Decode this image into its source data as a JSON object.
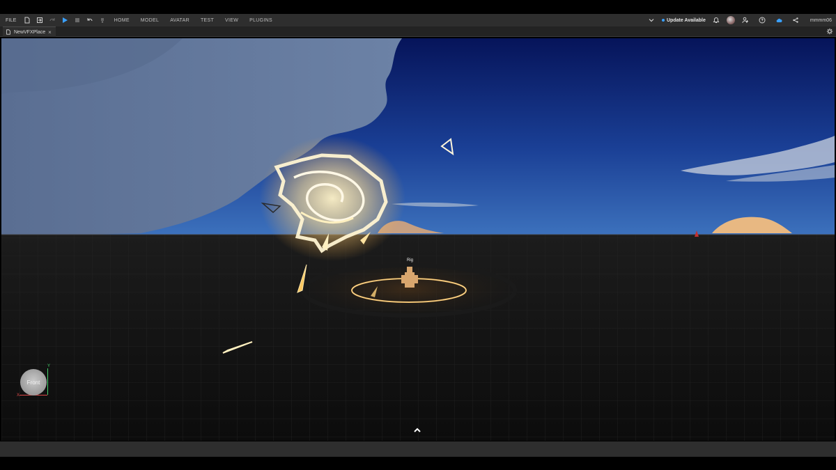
{
  "menubar": {
    "file_label": "FILE",
    "tabs": [
      "HOME",
      "MODEL",
      "AVATAR",
      "TEST",
      "VIEW",
      "PLUGINS"
    ],
    "update_label": "Update Available",
    "username": "mmmm06"
  },
  "document_tab": {
    "title": "NewVFXPlace",
    "close_glyph": "×"
  },
  "viewport": {
    "rig_label": "Rig",
    "view_cube": {
      "face_label": "Front",
      "axis_y": "Y",
      "axis_x": "X"
    }
  },
  "colors": {
    "sky_top": "#0b1f6e",
    "sky_horizon": "#3a6fb8",
    "ground": "#141414",
    "glow": "#ffd98a",
    "accent_blue": "#3aa0ff"
  },
  "icons": [
    "file-new-icon",
    "open-icon",
    "redo-icon",
    "play-icon",
    "stop-icon",
    "undo-icon",
    "chevron-down-icon",
    "bell-icon",
    "friends-icon",
    "help-icon",
    "cloud-icon",
    "share-icon",
    "gear-icon",
    "chevron-up-icon"
  ]
}
